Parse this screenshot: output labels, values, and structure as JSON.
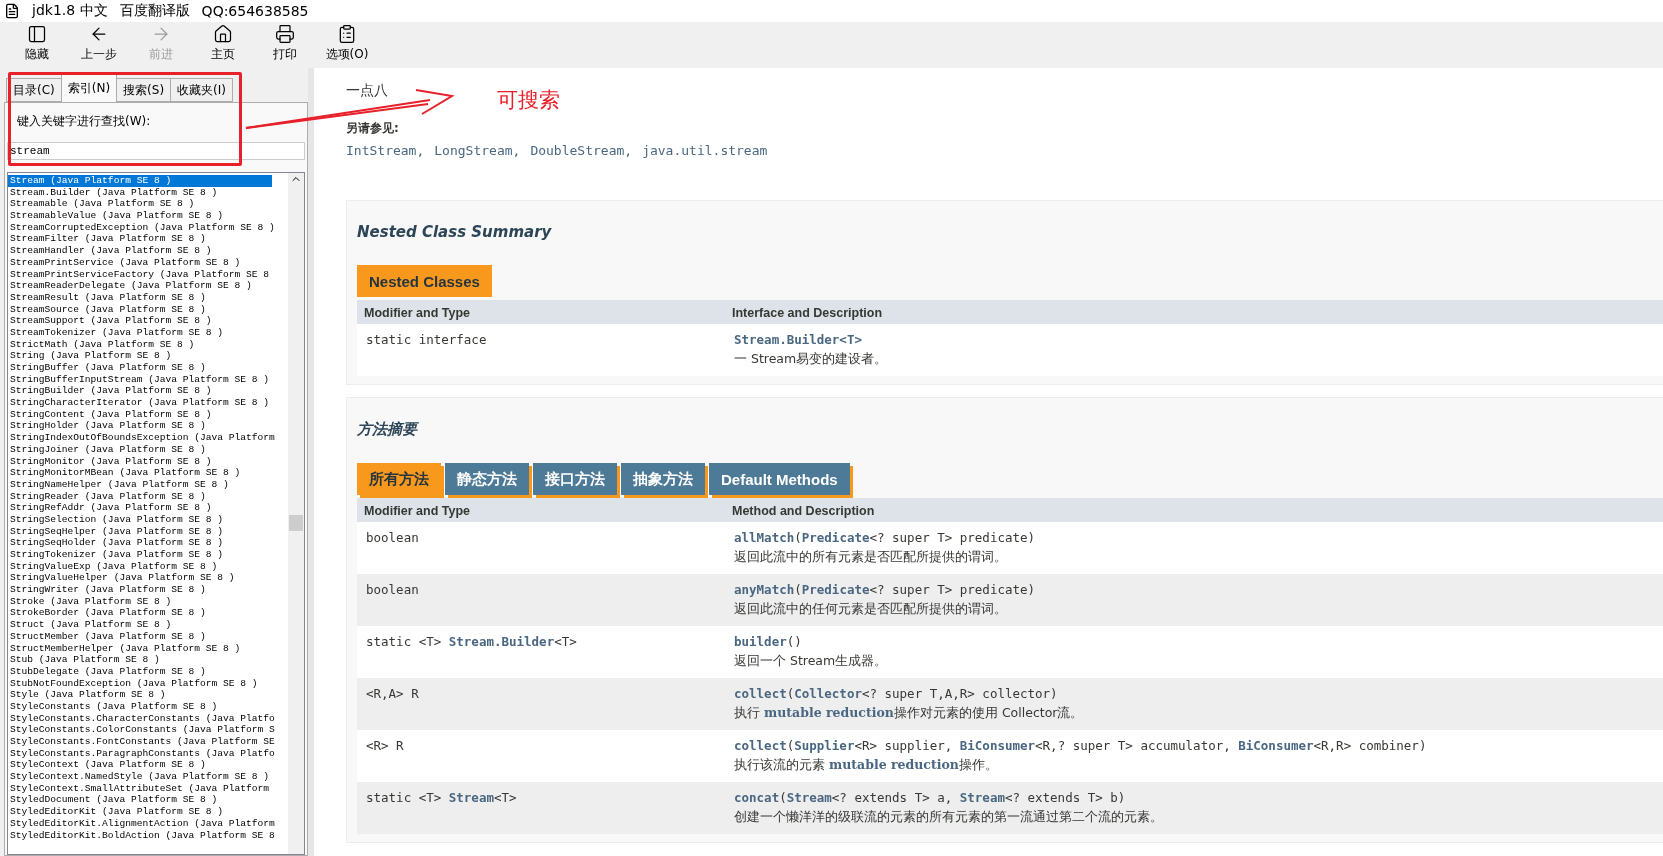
{
  "window": {
    "title_parts": [
      "jdk1.8 中文",
      "百度翻译版",
      "QQ:654638585"
    ]
  },
  "toolbar": [
    {
      "kind": "hide",
      "label": "隐藏",
      "disabled": false
    },
    {
      "kind": "back",
      "label": "上一步",
      "disabled": false
    },
    {
      "kind": "forward",
      "label": "前进",
      "disabled": true
    },
    {
      "kind": "home",
      "label": "主页",
      "disabled": false
    },
    {
      "kind": "print",
      "label": "打印",
      "disabled": false
    },
    {
      "kind": "options",
      "label": "选项(O)",
      "disabled": false
    }
  ],
  "sidebar": {
    "tabs": [
      {
        "label": "目录(C)",
        "selected": false
      },
      {
        "label": "索引(N)",
        "selected": true
      },
      {
        "label": "搜索(S)",
        "selected": false
      },
      {
        "label": "收藏夹(I)",
        "selected": false
      }
    ],
    "search_label": "键入关键字进行查找(W):",
    "search_value": "stream",
    "items": [
      {
        "label": "Stream (Java Platform SE 8 )",
        "selected": true
      },
      {
        "label": "Stream.Builder (Java Platform SE 8 )",
        "selected": false
      },
      {
        "label": "Streamable (Java Platform SE 8 )",
        "selected": false
      },
      {
        "label": "StreamableValue (Java Platform SE 8 )",
        "selected": false
      },
      {
        "label": "StreamCorruptedException (Java Platform SE 8 )",
        "selected": false
      },
      {
        "label": "StreamFilter (Java Platform SE 8 )",
        "selected": false
      },
      {
        "label": "StreamHandler (Java Platform SE 8 )",
        "selected": false
      },
      {
        "label": "StreamPrintService (Java Platform SE 8 )",
        "selected": false
      },
      {
        "label": "StreamPrintServiceFactory (Java Platform SE 8",
        "selected": false
      },
      {
        "label": "StreamReaderDelegate (Java Platform SE 8 )",
        "selected": false
      },
      {
        "label": "StreamResult (Java Platform SE 8 )",
        "selected": false
      },
      {
        "label": "StreamSource (Java Platform SE 8 )",
        "selected": false
      },
      {
        "label": "StreamSupport (Java Platform SE 8 )",
        "selected": false
      },
      {
        "label": "StreamTokenizer (Java Platform SE 8 )",
        "selected": false
      },
      {
        "label": "StrictMath (Java Platform SE 8 )",
        "selected": false
      },
      {
        "label": "String (Java Platform SE 8 )",
        "selected": false
      },
      {
        "label": "StringBuffer (Java Platform SE 8 )",
        "selected": false
      },
      {
        "label": "StringBufferInputStream (Java Platform SE 8 )",
        "selected": false
      },
      {
        "label": "StringBuilder (Java Platform SE 8 )",
        "selected": false
      },
      {
        "label": "StringCharacterIterator (Java Platform SE 8 )",
        "selected": false
      },
      {
        "label": "StringContent (Java Platform SE 8 )",
        "selected": false
      },
      {
        "label": "StringHolder (Java Platform SE 8 )",
        "selected": false
      },
      {
        "label": "StringIndexOutOfBoundsException (Java Platform",
        "selected": false
      },
      {
        "label": "StringJoiner (Java Platform SE 8 )",
        "selected": false
      },
      {
        "label": "StringMonitor (Java Platform SE 8 )",
        "selected": false
      },
      {
        "label": "StringMonitorMBean (Java Platform SE 8 )",
        "selected": false
      },
      {
        "label": "StringNameHelper (Java Platform SE 8 )",
        "selected": false
      },
      {
        "label": "StringReader (Java Platform SE 8 )",
        "selected": false
      },
      {
        "label": "StringRefAddr (Java Platform SE 8 )",
        "selected": false
      },
      {
        "label": "StringSelection (Java Platform SE 8 )",
        "selected": false
      },
      {
        "label": "StringSeqHelper (Java Platform SE 8 )",
        "selected": false
      },
      {
        "label": "StringSeqHolder (Java Platform SE 8 )",
        "selected": false
      },
      {
        "label": "StringTokenizer (Java Platform SE 8 )",
        "selected": false
      },
      {
        "label": "StringValueExp (Java Platform SE 8 )",
        "selected": false
      },
      {
        "label": "StringValueHelper (Java Platform SE 8 )",
        "selected": false
      },
      {
        "label": "StringWriter (Java Platform SE 8 )",
        "selected": false
      },
      {
        "label": "Stroke (Java Platform SE 8 )",
        "selected": false
      },
      {
        "label": "StrokeBorder (Java Platform SE 8 )",
        "selected": false
      },
      {
        "label": "Struct (Java Platform SE 8 )",
        "selected": false
      },
      {
        "label": "StructMember (Java Platform SE 8 )",
        "selected": false
      },
      {
        "label": "StructMemberHelper (Java Platform SE 8 )",
        "selected": false
      },
      {
        "label": "Stub (Java Platform SE 8 )",
        "selected": false
      },
      {
        "label": "StubDelegate (Java Platform SE 8 )",
        "selected": false
      },
      {
        "label": "StubNotFoundException (Java Platform SE 8 )",
        "selected": false
      },
      {
        "label": "Style (Java Platform SE 8 )",
        "selected": false
      },
      {
        "label": "StyleConstants (Java Platform SE 8 )",
        "selected": false
      },
      {
        "label": "StyleConstants.CharacterConstants (Java Platfo",
        "selected": false
      },
      {
        "label": "StyleConstants.ColorConstants (Java Platform S",
        "selected": false
      },
      {
        "label": "StyleConstants.FontConstants (Java Platform SE",
        "selected": false
      },
      {
        "label": "StyleConstants.ParagraphConstants (Java Platfo",
        "selected": false
      },
      {
        "label": "StyleContext (Java Platform SE 8 )",
        "selected": false
      },
      {
        "label": "StyleContext.NamedStyle (Java Platform SE 8 )",
        "selected": false
      },
      {
        "label": "StyleContext.SmallAttributeSet (Java Platform",
        "selected": false
      },
      {
        "label": "StyledDocument (Java Platform SE 8 )",
        "selected": false
      },
      {
        "label": "StyledEditorKit (Java Platform SE 8 )",
        "selected": false
      },
      {
        "label": "StyledEditorKit.AlignmentAction (Java Platform",
        "selected": false
      },
      {
        "label": "StyledEditorKit.BoldAction (Java Platform SE 8",
        "selected": false
      }
    ]
  },
  "content": {
    "since_value": "一点八",
    "see_also_label": "另请参见:",
    "see_also": [
      "IntStream,",
      "LongStream,",
      "DoubleStream,",
      "java.util.stream"
    ],
    "nested": {
      "title": "Nested Class Summary",
      "tab": "Nested Classes",
      "columns": [
        "Modifier and Type",
        "Interface and Description"
      ],
      "rows": [
        {
          "modifier": "static interface",
          "name": "**Stream.Builder<T>**",
          "description": "一 Stream易变的建设者。"
        }
      ]
    },
    "methods": {
      "title": "方法摘要",
      "tabs": [
        {
          "label": "所有方法",
          "selected": true
        },
        {
          "label": "静态方法",
          "selected": false
        },
        {
          "label": "接口方法",
          "selected": false
        },
        {
          "label": "抽象方法",
          "selected": false
        },
        {
          "label": "Default Methods",
          "selected": false
        }
      ],
      "columns": [
        "Modifier and Type",
        "Method and Description"
      ],
      "rows": [
        {
          "modifier": "boolean",
          "name": "**allMatch**(**Predicate**<? super T> predicate)",
          "description": "返回此流中的所有元素是否匹配所提供的谓词。"
        },
        {
          "modifier": "boolean",
          "name": "**anyMatch**(**Predicate**<? super T> predicate)",
          "description": "返回此流中的任何元素是否匹配所提供的谓词。"
        },
        {
          "modifier": "static <T> **Stream.Builder**<T>",
          "name": "**builder**()",
          "description": "返回一个 Stream生成器。"
        },
        {
          "modifier": "<R,A> R",
          "name": "**collect**(**Collector**<? super T,A,R> collector)",
          "description": "执行 **mutable reduction**操作对元素的使用 Collector流。"
        },
        {
          "modifier": "<R> R",
          "name": "**collect**(**Supplier**<R> supplier, **BiConsumer**<R,? super T> accumulator, **BiConsumer**<R,R> combiner)",
          "description": "执行该流的元素 **mutable reduction**操作。"
        },
        {
          "modifier": "static <T> **Stream**<T>",
          "name": "**concat**(**Stream**<? extends T> a, **Stream**<? extends T> b)",
          "description": "创建一个懒洋洋的级联流的元素的所有元素的第一流通过第二个流的元素。"
        }
      ]
    }
  },
  "annotation": {
    "label": "可搜索"
  }
}
